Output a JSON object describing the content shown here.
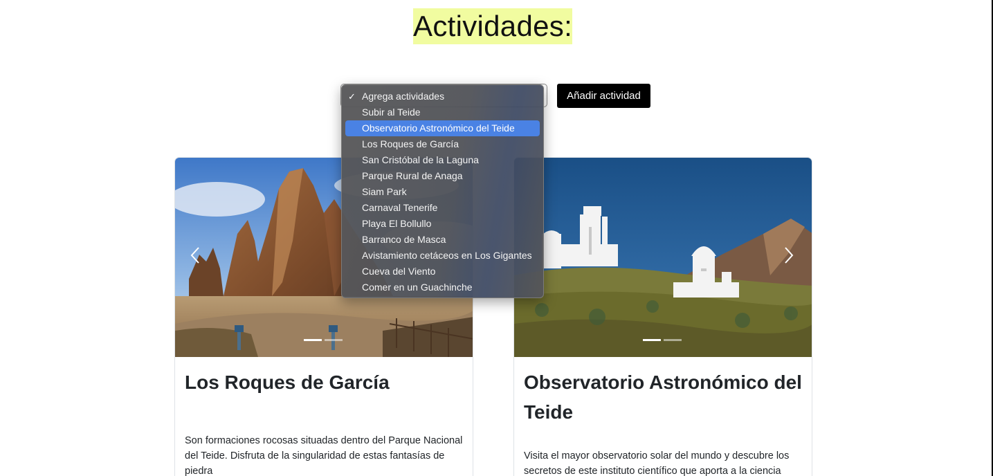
{
  "header": {
    "title": "Actividades:"
  },
  "form": {
    "select_value": "Agrega actividades",
    "add_button_label": "Añadir actividad"
  },
  "dropdown": {
    "checked_index": 0,
    "highlighted_index": 2,
    "options": [
      "Agrega actividades",
      "Subir al Teide",
      "Observatorio Astronómico del Teide",
      "Los Roques de García",
      "San Cristóbal de la Laguna",
      "Parque Rural de Anaga",
      "Siam Park",
      "Carnaval Tenerife",
      "Playa El Bollullo",
      "Barranco de Masca",
      "Avistamiento cetáceos en Los Gigantes",
      "Cueva del Viento",
      "Comer en un Guachinche"
    ],
    "check_glyph": "✓"
  },
  "cards": [
    {
      "title": "Los Roques de García",
      "text": "Son formaciones rocosas situadas dentro del Parque Nacional del Teide. Disfruta de la singularidad de estas fantasías de piedra"
    },
    {
      "title": "Observatorio Astronómico del Teide",
      "text": "Visita el mayor observatorio solar del mundo y descubre los secretos de este instituto científico que aporta a la ciencia"
    }
  ],
  "colors": {
    "title_highlight": "#f1fca0",
    "button_bg": "#000000",
    "dropdown_selected": "#4a82e4"
  },
  "icons": [
    "chevron-left-icon",
    "chevron-right-icon",
    "checkmark-icon"
  ]
}
